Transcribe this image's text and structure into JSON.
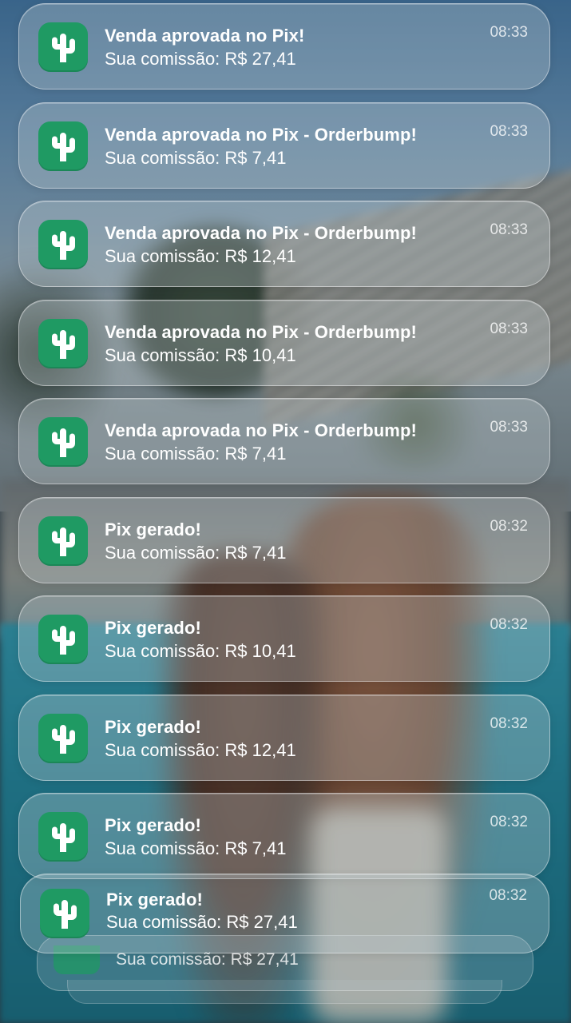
{
  "icon": "cactus-icon",
  "accent_color": "#1f9a63",
  "notifications": [
    {
      "title": "Venda aprovada no Pix!",
      "body": "Sua comissão: R$ 27,41",
      "time": "08:33"
    },
    {
      "title": "Venda aprovada no Pix - Orderbump!",
      "body": "Sua comissão: R$ 7,41",
      "time": "08:33"
    },
    {
      "title": "Venda aprovada no Pix - Orderbump!",
      "body": "Sua comissão: R$ 12,41",
      "time": "08:33"
    },
    {
      "title": "Venda aprovada no Pix - Orderbump!",
      "body": "Sua comissão: R$ 10,41",
      "time": "08:33"
    },
    {
      "title": "Venda aprovada no Pix - Orderbump!",
      "body": "Sua comissão: R$ 7,41",
      "time": "08:33"
    },
    {
      "title": "Pix gerado!",
      "body": "Sua comissão: R$ 7,41",
      "time": "08:32"
    },
    {
      "title": "Pix gerado!",
      "body": "Sua comissão: R$ 10,41",
      "time": "08:32"
    },
    {
      "title": "Pix gerado!",
      "body": "Sua comissão: R$ 12,41",
      "time": "08:32"
    },
    {
      "title": "Pix gerado!",
      "body": "Sua comissão: R$ 7,41",
      "time": "08:32"
    },
    {
      "title": "Pix gerado!",
      "body": "Sua comissão: R$ 27,41",
      "time": "08:32"
    }
  ],
  "stacked_preview": {
    "body": "Sua comissão: R$ 27,41"
  }
}
